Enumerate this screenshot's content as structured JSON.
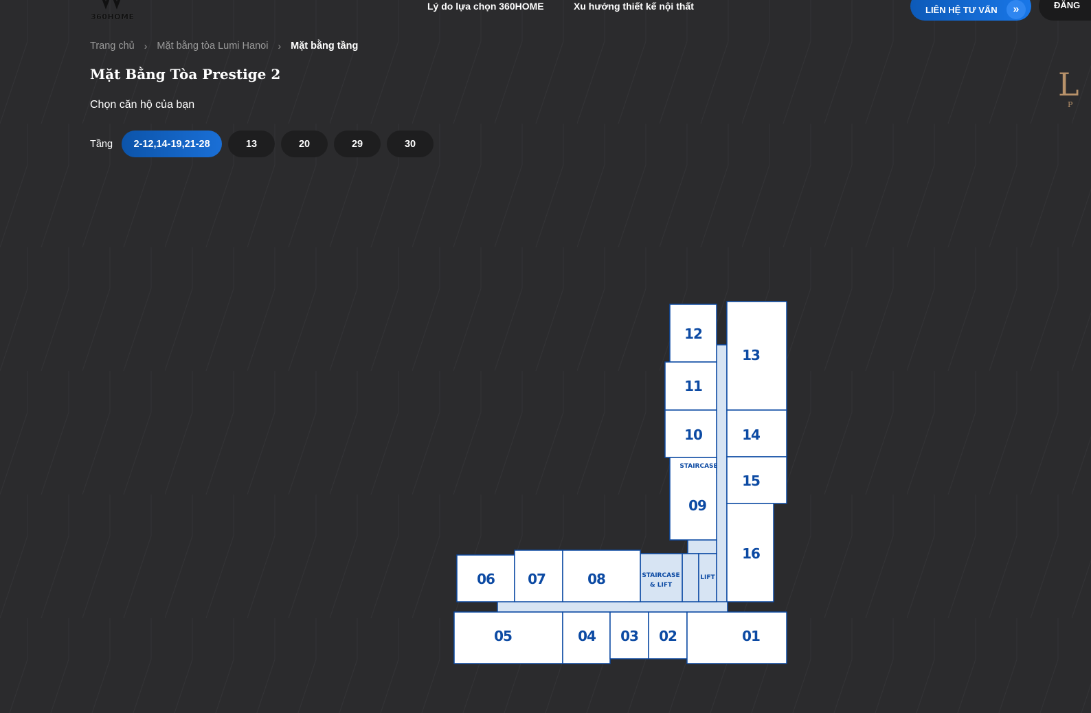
{
  "header": {
    "brand": "360HOME",
    "nav": [
      "Lý do lựa chọn 360HOME",
      "Xu hướng thiết kế nội thất"
    ],
    "contact_label": "LIÊN HỆ TƯ VẤN",
    "contact_icon": "double-chevron-right-icon",
    "login_label": "ĐĂNG"
  },
  "side_logo": {
    "letter": "L",
    "sub": "P"
  },
  "breadcrumb": {
    "items": [
      "Trang chủ",
      "Mặt bằng tòa Lumi Hanoi"
    ],
    "current": "Mặt bằng tầng"
  },
  "page_title": "Mặt Bằng Tòa Prestige 2",
  "subtitle": "Chọn căn hộ của bạn",
  "floors": {
    "label": "Tầng",
    "options": [
      "2-12,14-19,21-28",
      "13",
      "20",
      "29",
      "30"
    ],
    "selected": "2-12,14-19,21-28"
  },
  "floor_plan": {
    "units": [
      "01",
      "02",
      "03",
      "04",
      "05",
      "06",
      "07",
      "08",
      "09",
      "10",
      "11",
      "12",
      "13",
      "14",
      "15",
      "16"
    ],
    "service_labels": [
      "STAIRCASE",
      "STAIRCASE",
      "& LIFT",
      "LIFT"
    ]
  },
  "colors": {
    "background": "#2b2b2d",
    "accent": "#1a6fd6",
    "plan_stroke": "#0c4aa3",
    "plan_corridor": "#d7e4f3"
  }
}
